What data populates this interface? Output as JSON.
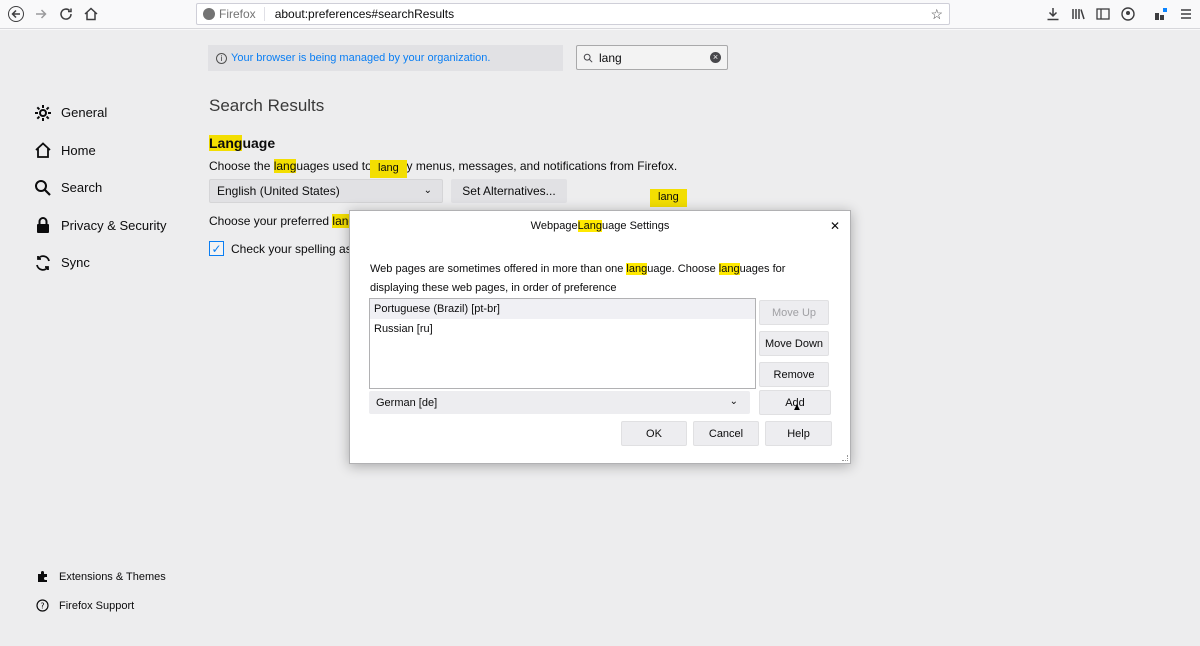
{
  "toolbar": {
    "identity_label": "Firefox",
    "url": "about:preferences#searchResults"
  },
  "managed_notice": "Your browser is being managed by your organization.",
  "search": {
    "value": "lang"
  },
  "nav": {
    "items": [
      {
        "label": "General",
        "icon": "gear-icon"
      },
      {
        "label": "Home",
        "icon": "home-icon"
      },
      {
        "label": "Search",
        "icon": "search-icon"
      },
      {
        "label": "Privacy & Security",
        "icon": "lock-icon"
      },
      {
        "label": "Sync",
        "icon": "sync-icon"
      }
    ],
    "bottom": [
      {
        "label": "Extensions & Themes",
        "icon": "puzzle-icon"
      },
      {
        "label": "Firefox Support",
        "icon": "help-icon"
      }
    ]
  },
  "content": {
    "title": "Search Results",
    "section_title_hl": "Lang",
    "section_title_rest": "uage",
    "desc_pre": "Choose the ",
    "desc_hl": "lang",
    "desc_post": "uages used to display menus, messages, and notifications from Firefox.",
    "tooltip_1": "lang",
    "tooltip_2": "lang",
    "ui_language": "English (United States)",
    "set_alternatives": "Set Alternatives...",
    "pref_pre": "Choose your preferred ",
    "pref_hl": "lang",
    "spell_check_label": "Check your spelling as you type",
    "spell_check_checked": true
  },
  "dialog": {
    "title_pre": "Webpage ",
    "title_hl": "Lang",
    "title_post": "uage Settings",
    "desc_1": "Web pages are sometimes offered in more than one ",
    "desc_hl_1": "lang",
    "desc_2": "uage. Choose ",
    "desc_hl_2": "lang",
    "desc_3": "uages for displaying these web pages, in order of preference",
    "languages": [
      "Portuguese (Brazil) [pt-br]",
      "Russian [ru]"
    ],
    "move_up": "Move Up",
    "move_down": "Move Down",
    "remove": "Remove",
    "add_select_value": "German [de]",
    "add": "Add",
    "ok": "OK",
    "cancel": "Cancel",
    "help": "Help"
  }
}
